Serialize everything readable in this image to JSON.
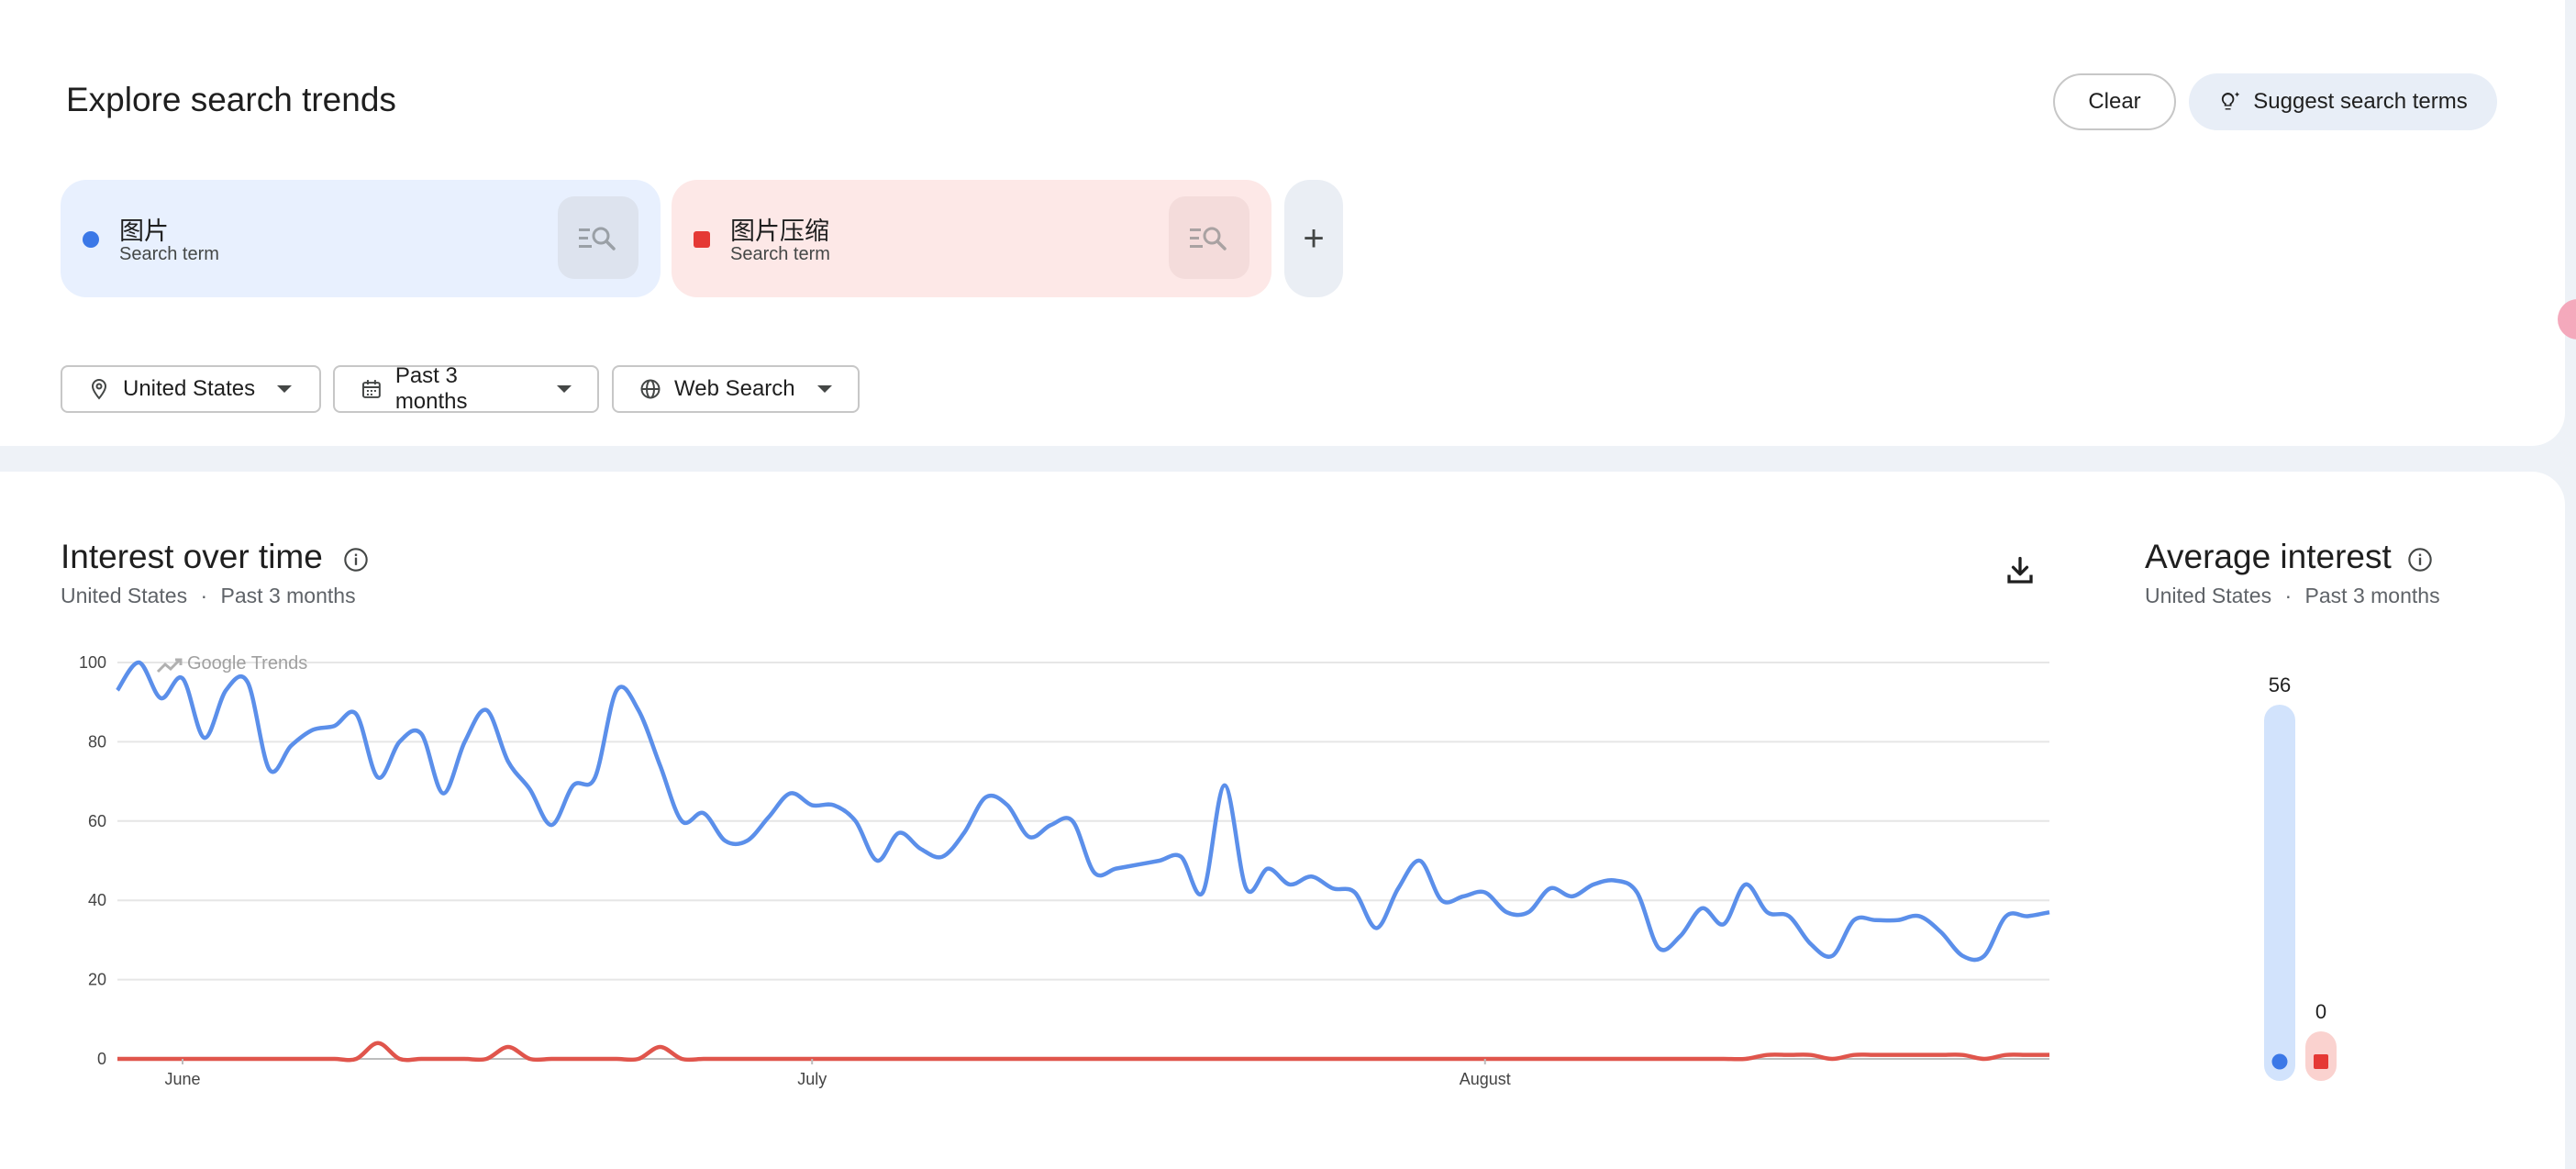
{
  "header": {
    "title": "Explore search trends",
    "clear_label": "Clear",
    "suggest_label": "Suggest search terms"
  },
  "terms": [
    {
      "name": "图片",
      "sub": "Search term",
      "color": "#3b78e7",
      "marker": "circle"
    },
    {
      "name": "图片压缩",
      "sub": "Search term",
      "color": "#e53935",
      "marker": "square"
    }
  ],
  "add_term_label": "+",
  "filters": {
    "region": "United States",
    "time": "Past 3 months",
    "property": "Web Search"
  },
  "interest": {
    "title": "Interest over time",
    "subtitle_region": "United States",
    "subtitle_sep": "·",
    "subtitle_time": "Past 3 months",
    "watermark": "Google Trends"
  },
  "average": {
    "title": "Average interest",
    "subtitle_region": "United States",
    "subtitle_sep": "·",
    "subtitle_time": "Past 3 months"
  },
  "chart_data": [
    {
      "type": "line",
      "title": "Interest over time",
      "ylim": [
        0,
        100
      ],
      "yticks": [
        0,
        20,
        40,
        60,
        80,
        100
      ],
      "xtick_labels": [
        {
          "label": "June",
          "index": 3
        },
        {
          "label": "July",
          "index": 32
        },
        {
          "label": "August",
          "index": 63
        }
      ],
      "grid": true,
      "series": [
        {
          "name": "图片",
          "color": "#5b8fea",
          "values": [
            93,
            100,
            91,
            96,
            81,
            93,
            95,
            73,
            79,
            83,
            84,
            87,
            71,
            80,
            82,
            67,
            80,
            88,
            75,
            68,
            59,
            69,
            71,
            93,
            88,
            74,
            60,
            62,
            55,
            55,
            61,
            67,
            64,
            64,
            60,
            50,
            57,
            53,
            51,
            57,
            66,
            64,
            56,
            59,
            60,
            47,
            48,
            49,
            50,
            51,
            42,
            69,
            43,
            48,
            44,
            46,
            43,
            42,
            33,
            43,
            50,
            40,
            41,
            42,
            37,
            37,
            43,
            41,
            44,
            45,
            42,
            28,
            31,
            38,
            34,
            44,
            37,
            36,
            29,
            26,
            35,
            35,
            35,
            36,
            32,
            26,
            26,
            36,
            36,
            37
          ]
        },
        {
          "name": "图片压缩",
          "color": "#e0554c",
          "values": [
            0,
            0,
            0,
            0,
            0,
            0,
            0,
            0,
            0,
            0,
            0,
            0,
            4,
            0,
            0,
            0,
            0,
            0,
            3,
            0,
            0,
            0,
            0,
            0,
            0,
            3,
            0,
            0,
            0,
            0,
            0,
            0,
            0,
            0,
            0,
            0,
            0,
            0,
            0,
            0,
            0,
            0,
            0,
            0,
            0,
            0,
            0,
            0,
            0,
            0,
            0,
            0,
            0,
            0,
            0,
            0,
            0,
            0,
            0,
            0,
            0,
            0,
            0,
            0,
            0,
            0,
            0,
            0,
            0,
            0,
            0,
            0,
            0,
            0,
            0,
            0,
            1,
            1,
            1,
            0,
            1,
            1,
            1,
            1,
            1,
            1,
            0,
            1,
            1,
            1
          ]
        }
      ]
    },
    {
      "type": "bar",
      "title": "Average interest",
      "ylim": [
        0,
        56
      ],
      "series": [
        {
          "name": "图片",
          "value": 56,
          "color": "#d2e3fc",
          "marker_color": "#3b78e7"
        },
        {
          "name": "图片压缩",
          "value": 0,
          "color": "#fad2cf",
          "marker_color": "#e53935"
        }
      ]
    }
  ]
}
